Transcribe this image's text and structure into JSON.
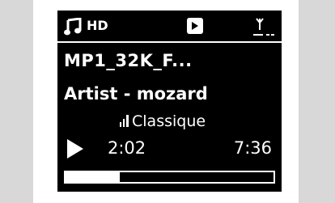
{
  "status_bar": {
    "source_icon": "music-note-icon",
    "quality_label": "HD",
    "mode_icon": "shuffle-icon",
    "signal_icon": "antenna-signal-icon"
  },
  "track": {
    "title": "MP1_32K_F...",
    "artist_line": "Artist - mozard",
    "genre": "Classique",
    "genre_icon": "bar-graph-icon"
  },
  "playback": {
    "state_icon": "play-icon",
    "elapsed": "2:02",
    "total": "7:36",
    "progress": 0.26
  },
  "colors": {
    "screen_background": "#000000",
    "screen_foreground": "#ffffff",
    "bezel": "#ffffff",
    "surround": "#d8d8d8"
  }
}
